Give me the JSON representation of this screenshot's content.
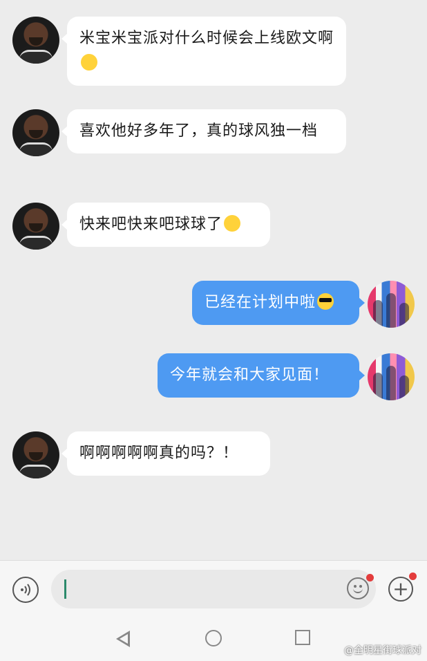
{
  "messages": [
    {
      "side": "left",
      "text": "米宝米宝派对什么时候会上线欧文啊",
      "emoji": "crying-face"
    },
    {
      "side": "left",
      "text": "喜欢他好多年了，真的球风独一档",
      "emoji": ""
    },
    {
      "side": "left",
      "text": "快来吧快来吧球球了",
      "emoji": "pleading-face"
    },
    {
      "side": "right",
      "text": "已经在计划中啦",
      "emoji": "sunglasses-face"
    },
    {
      "side": "right",
      "text": "今年就会和大家见面！",
      "emoji": ""
    },
    {
      "side": "left",
      "text": "啊啊啊啊啊真的吗？！",
      "emoji": ""
    }
  ],
  "input": {
    "value": "",
    "placeholder": ""
  },
  "icons": {
    "voice": "voice-icon",
    "emoji": "emoji-icon",
    "plus": "plus-icon",
    "back": "back-nav-icon",
    "home": "home-nav-icon",
    "recent": "recent-apps-icon"
  },
  "colors": {
    "outgoing_bubble": "#4e9af2",
    "incoming_bubble": "#ffffff",
    "badge": "#e33c3c",
    "background": "#ececec"
  },
  "watermark": "@全明星街球派对"
}
